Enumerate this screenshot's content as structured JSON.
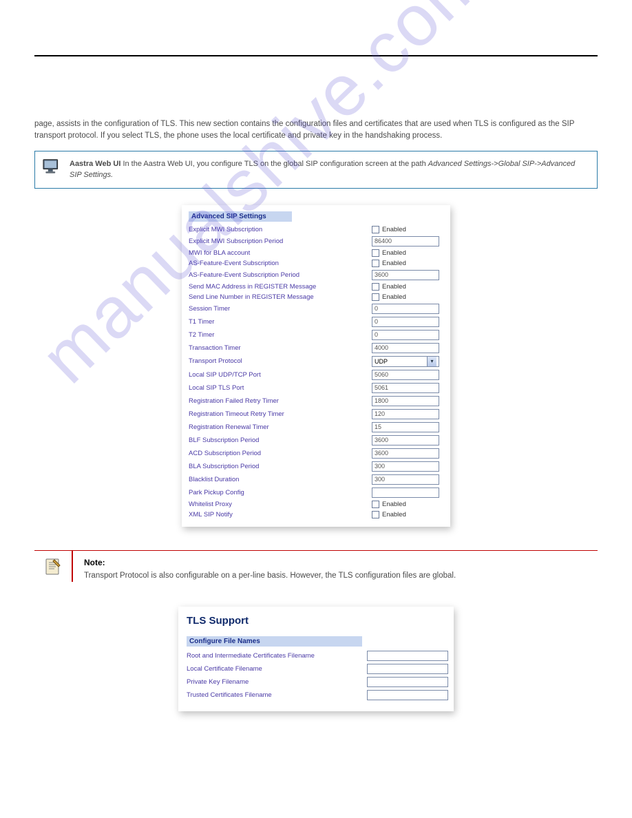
{
  "watermark": "manualshive.com",
  "intro_paragraph": "page, assists in the configuration of TLS. This new section contains the configuration files and certificates that are used when TLS is configured as the SIP transport protocol. If you select TLS, the phone uses the local certificate and private key in the handshaking process.",
  "callout_lead": "Aastra Web UI",
  "callout_text": " In the Aastra Web UI, you configure TLS on the global SIP configuration screen at the path ",
  "callout_path": "Advanced Settings->Global SIP->Advanced SIP Settings.",
  "adv_panel": {
    "heading": "Advanced SIP Settings",
    "rows": [
      {
        "label": "Explicit MWI Subscription",
        "type": "check",
        "value": "Enabled"
      },
      {
        "label": "Explicit MWI Subscription Period",
        "type": "text",
        "value": "86400"
      },
      {
        "label": "MWI for BLA account",
        "type": "check",
        "value": "Enabled"
      },
      {
        "label": "AS-Feature-Event Subscription",
        "type": "check",
        "value": "Enabled"
      },
      {
        "label": "AS-Feature-Event Subscription Period",
        "type": "text",
        "value": "3600"
      },
      {
        "label": "Send MAC Address in REGISTER Message",
        "type": "check",
        "value": "Enabled"
      },
      {
        "label": "Send Line Number in REGISTER Message",
        "type": "check",
        "value": "Enabled"
      },
      {
        "label": "Session Timer",
        "type": "text",
        "value": "0"
      },
      {
        "label": "T1 Timer",
        "type": "text",
        "value": "0"
      },
      {
        "label": "T2 Timer",
        "type": "text",
        "value": "0"
      },
      {
        "label": "Transaction Timer",
        "type": "text",
        "value": "4000"
      },
      {
        "label": "Transport Protocol",
        "type": "select",
        "value": "UDP"
      },
      {
        "label": "Local SIP UDP/TCP Port",
        "type": "text",
        "value": "5060"
      },
      {
        "label": "Local SIP TLS Port",
        "type": "text",
        "value": "5061"
      },
      {
        "label": "Registration Failed Retry Timer",
        "type": "text",
        "value": "1800"
      },
      {
        "label": "Registration Timeout Retry Timer",
        "type": "text",
        "value": "120"
      },
      {
        "label": "Registration Renewal Timer",
        "type": "text",
        "value": "15"
      },
      {
        "label": "BLF Subscription Period",
        "type": "text",
        "value": "3600"
      },
      {
        "label": "ACD Subscription Period",
        "type": "text",
        "value": "3600"
      },
      {
        "label": "BLA Subscription Period",
        "type": "text",
        "value": "300"
      },
      {
        "label": "Blacklist Duration",
        "type": "text",
        "value": "300"
      },
      {
        "label": "Park Pickup Config",
        "type": "text",
        "value": ""
      },
      {
        "label": "Whitelist Proxy",
        "type": "check",
        "value": "Enabled"
      },
      {
        "label": "XML SIP Notify",
        "type": "check",
        "value": "Enabled"
      }
    ]
  },
  "note_title": "Note:",
  "note_text": "Transport Protocol is also configurable on a per-line basis. However, the TLS configuration files are global.",
  "tls_panel": {
    "title": "TLS Support",
    "subheading": "Configure File Names",
    "rows": [
      {
        "label": "Root and Intermediate Certificates Filename"
      },
      {
        "label": "Local Certificate Filename"
      },
      {
        "label": "Private Key Filename"
      },
      {
        "label": "Trusted Certificates Filename"
      }
    ]
  }
}
